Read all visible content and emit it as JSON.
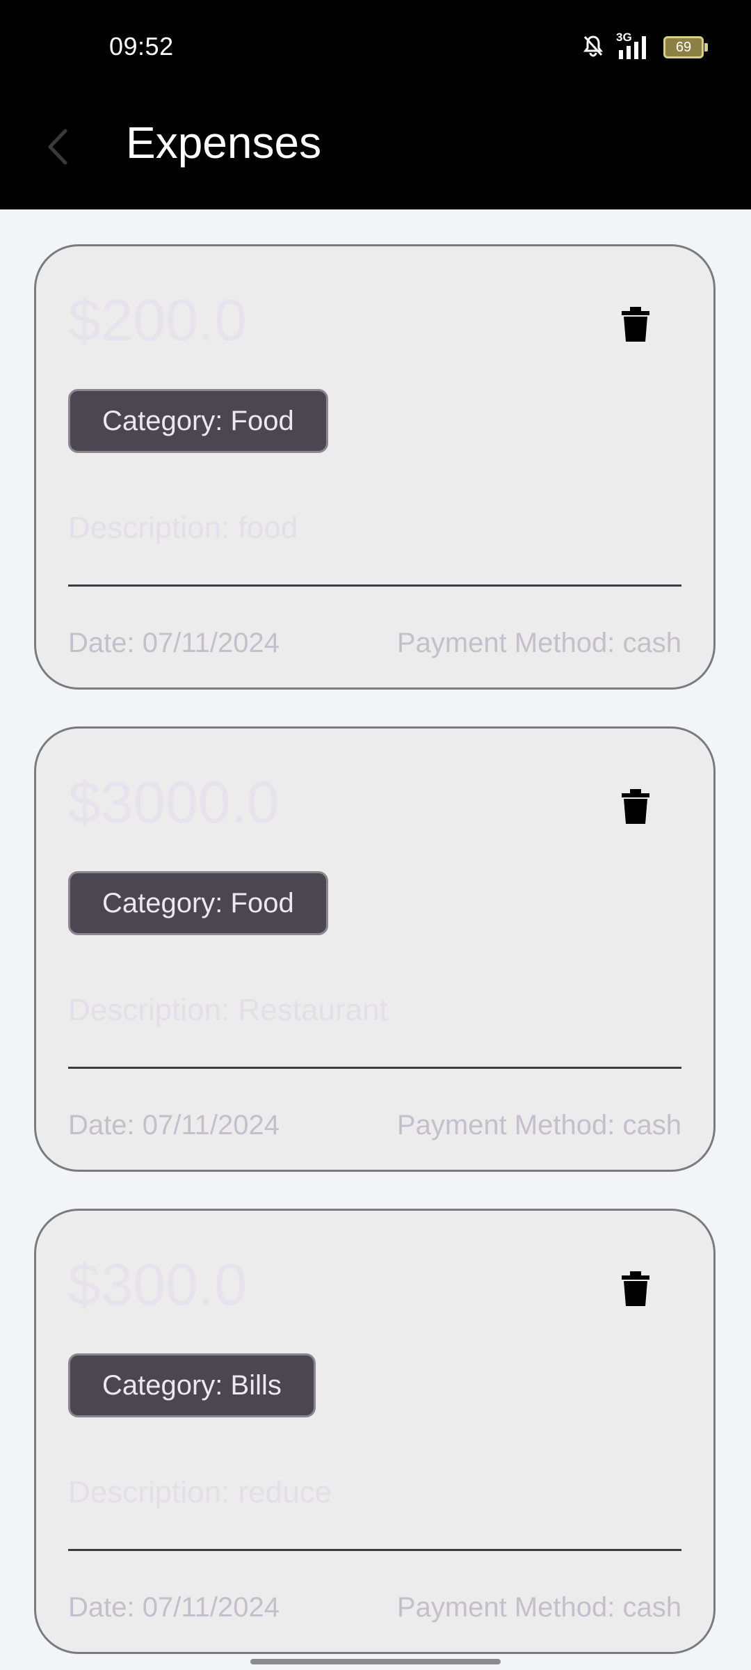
{
  "status_bar": {
    "time": "09:52",
    "network": "3G",
    "battery": "69"
  },
  "app_bar": {
    "title": "Expenses"
  },
  "expenses": [
    {
      "amount": "$200.0",
      "category": "Category: Food",
      "description": "Description: food",
      "date": "Date: 07/11/2024",
      "payment": "Payment Method: cash"
    },
    {
      "amount": "$3000.0",
      "category": "Category: Food",
      "description": "Description: Restaurant",
      "date": "Date: 07/11/2024",
      "payment": "Payment Method: cash"
    },
    {
      "amount": "$300.0",
      "category": "Category: Bills",
      "description": "Description: reduce",
      "date": "Date: 07/11/2024",
      "payment": "Payment Method: cash"
    }
  ]
}
